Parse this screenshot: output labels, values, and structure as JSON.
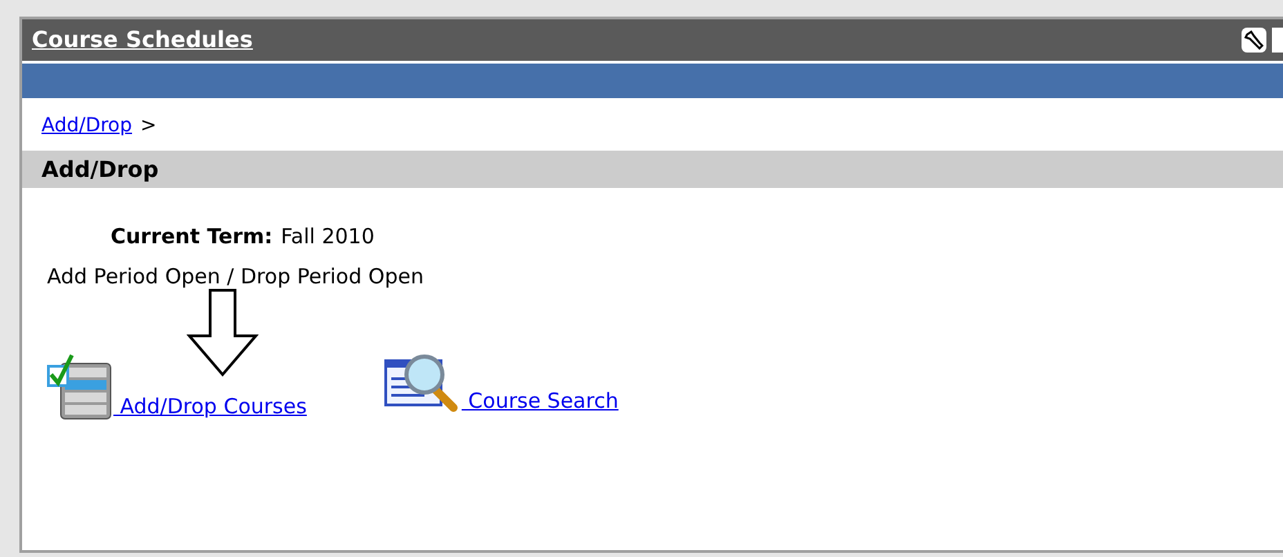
{
  "portlet": {
    "title": "Course Schedules"
  },
  "breadcrumb": {
    "link": "Add/Drop",
    "separator": ">"
  },
  "section": {
    "title": "Add/Drop"
  },
  "term": {
    "label": "Current Term:",
    "value": "Fall 2010"
  },
  "period_status": "Add Period Open / Drop Period Open",
  "links": [
    {
      "kind": "checklist",
      "label": " Add/Drop Courses"
    },
    {
      "kind": "search",
      "label": " Course Search"
    }
  ]
}
